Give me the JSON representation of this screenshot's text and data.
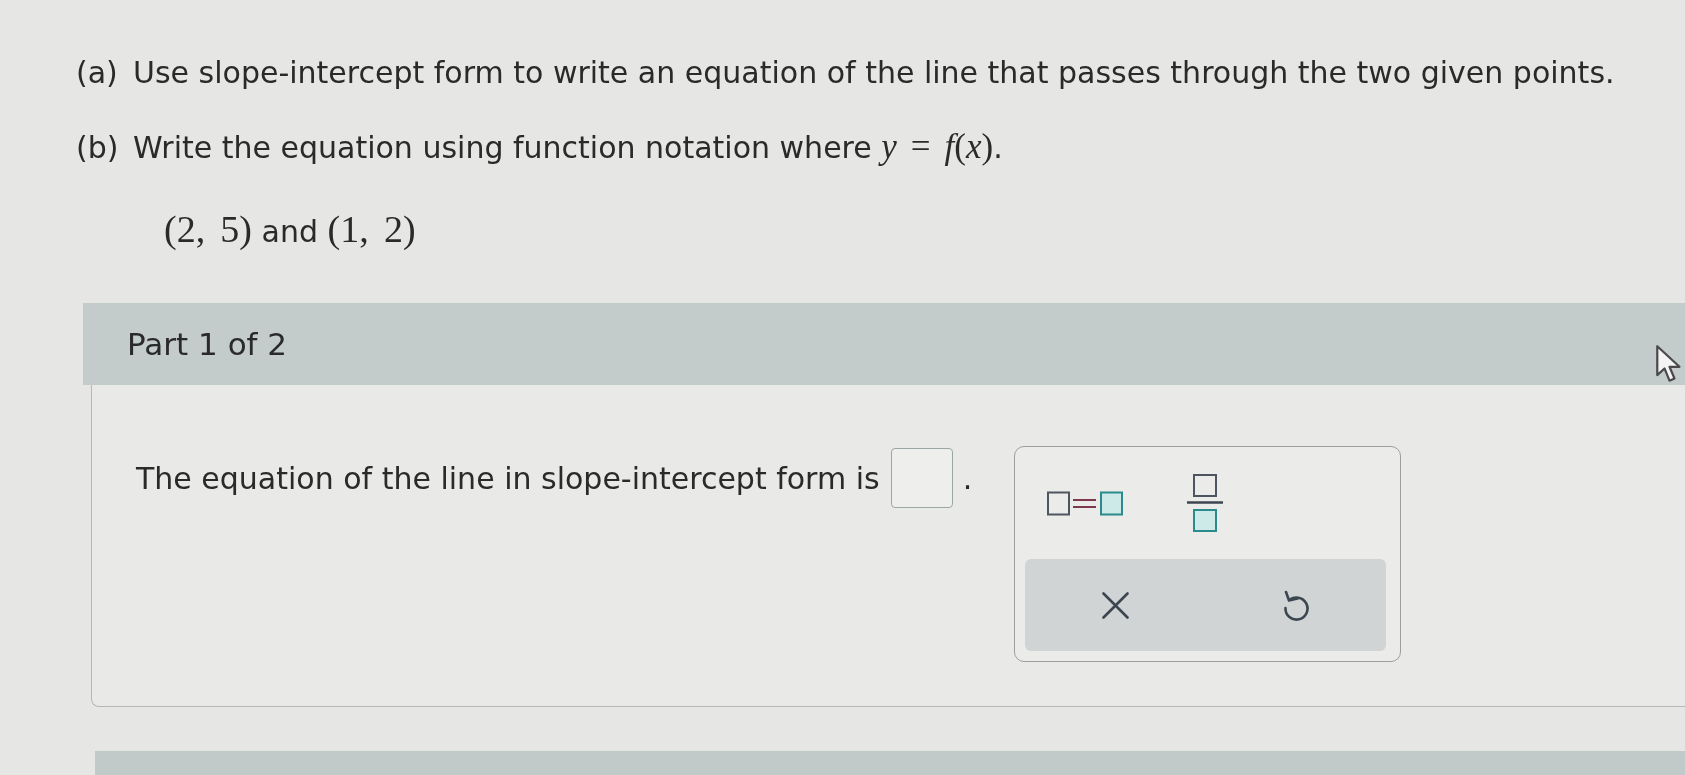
{
  "question": {
    "parts": [
      {
        "label": "(a)",
        "segments": [
          {
            "kind": "text",
            "text": "Use slope-intercept form to write an equation of the line that passes through the two given points."
          }
        ]
      },
      {
        "label": "(b)",
        "segments": [
          {
            "kind": "text",
            "text": "Write the equation using function notation where "
          },
          {
            "kind": "math",
            "text": "*y* = *f*(*x*)"
          },
          {
            "kind": "text",
            "text": "."
          }
        ]
      }
    ],
    "points": [
      {
        "kind": "math",
        "text": "(2, 5)"
      },
      {
        "kind": "text",
        "text": " and "
      },
      {
        "kind": "math",
        "text": "(1, 2)"
      }
    ]
  },
  "part_header": {
    "title": "Part 1 of 2"
  },
  "answer": {
    "prompt": "The equation of the line in slope-intercept form is",
    "after": "."
  },
  "toolbar": {
    "templates": [
      {
        "kind": "equation"
      },
      {
        "kind": "fraction"
      }
    ],
    "actions": [
      {
        "kind": "clear"
      },
      {
        "kind": "undo"
      }
    ]
  }
}
